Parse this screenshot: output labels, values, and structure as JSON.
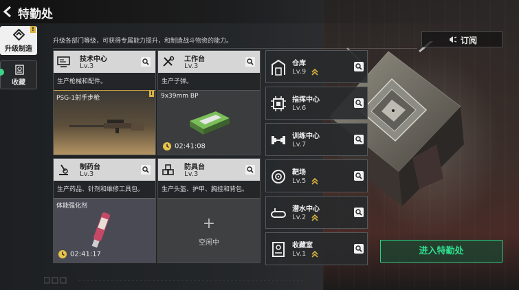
{
  "header": {
    "title": "特勤处"
  },
  "sidebar": {
    "tabs": [
      {
        "label": "升级制造",
        "active": true,
        "badge": "!"
      },
      {
        "label": "收藏",
        "active": false
      }
    ]
  },
  "subtitle": "升级各部门等级，可获得专属能力提升，和制造战斗物资的能力。",
  "subscribe_label": "订阅",
  "cards": [
    {
      "name": "技术中心",
      "level": "Lv.3",
      "desc": "生产枪械和配件。",
      "product": "PSG-1射手步枪",
      "badge": "!",
      "icon": "monitor-icon"
    },
    {
      "name": "工作台",
      "level": "Lv.3",
      "desc": "生产子弹。",
      "product": "9x39mm BP",
      "timer": "02:41:08",
      "icon": "tools-icon"
    },
    {
      "name": "制药台",
      "level": "Lv.3",
      "desc": "生产药品、针剂和维修工具包。",
      "product": "体能强化剂",
      "timer": "02:41:17",
      "icon": "microscope-icon"
    },
    {
      "name": "防具台",
      "level": "Lv.3",
      "desc": "生产头盔、护甲、胸挂和背包。",
      "idle_plus": "+",
      "idle_label": "空闲中",
      "icon": "cubes-icon"
    }
  ],
  "facilities": [
    {
      "name": "仓库",
      "level": "Lv.9",
      "upgradable": true,
      "icon": "warehouse-icon"
    },
    {
      "name": "指挥中心",
      "level": "Lv.6",
      "upgradable": false,
      "icon": "chip-icon"
    },
    {
      "name": "训练中心",
      "level": "Lv.7",
      "upgradable": false,
      "icon": "dumbbell-icon"
    },
    {
      "name": "靶场",
      "level": "Lv.5",
      "upgradable": true,
      "icon": "target-icon"
    },
    {
      "name": "潜水中心",
      "level": "Lv.2",
      "upgradable": true,
      "icon": "dive-icon"
    },
    {
      "name": "收藏室",
      "level": "Lv.1",
      "upgradable": true,
      "icon": "collection-icon"
    }
  ],
  "enter_label": "进入特勤处",
  "colors": {
    "accent_green": "#2fe08f",
    "upgrade_yellow": "#d9b440",
    "header_gray": "#d6d6d6"
  }
}
